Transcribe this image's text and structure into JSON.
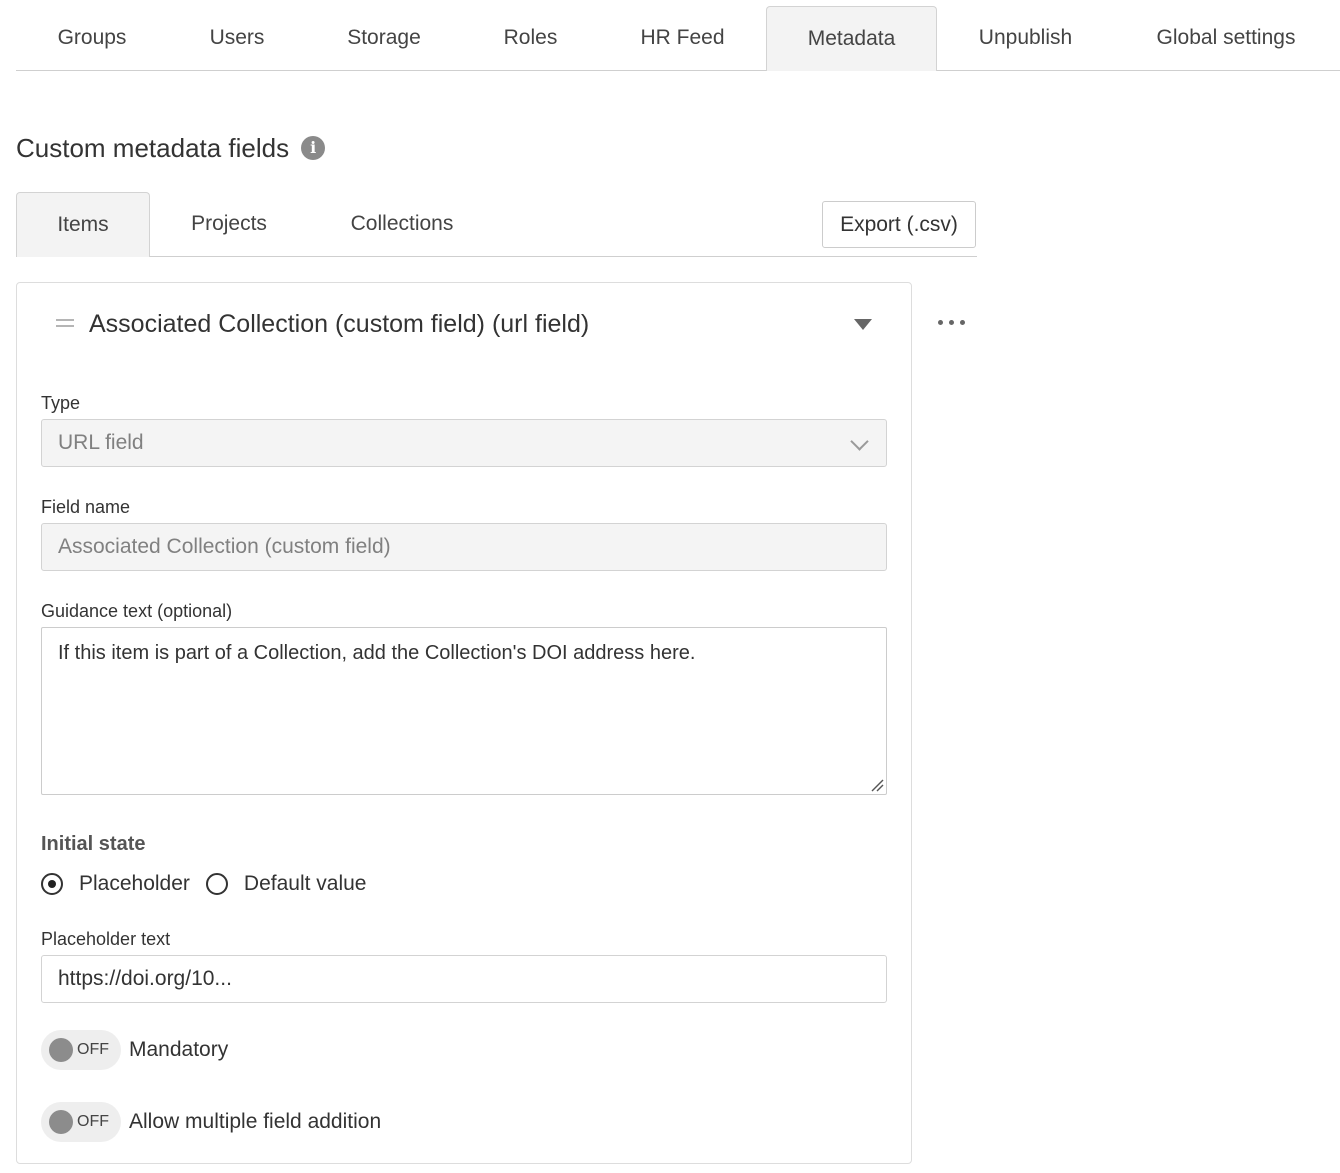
{
  "top_nav": {
    "tabs": [
      {
        "label": "Groups"
      },
      {
        "label": "Users"
      },
      {
        "label": "Storage"
      },
      {
        "label": "Roles"
      },
      {
        "label": "HR Feed"
      },
      {
        "label": "Metadata",
        "active": true
      },
      {
        "label": "Unpublish"
      },
      {
        "label": "Global settings"
      }
    ]
  },
  "section": {
    "title": "Custom metadata fields",
    "info_icon": "info-icon"
  },
  "sub_tabs": {
    "tabs": [
      {
        "label": "Items",
        "active": true
      },
      {
        "label": "Projects"
      },
      {
        "label": "Collections"
      }
    ],
    "export_label": "Export (.csv)"
  },
  "field_card": {
    "title": "Associated Collection (custom field) (url field)",
    "type": {
      "label": "Type",
      "value": "URL field"
    },
    "field_name": {
      "label": "Field name",
      "value": "Associated Collection (custom field)"
    },
    "guidance": {
      "label": "Guidance text (optional)",
      "value": "If this item is part of a Collection, add the Collection's DOI address here."
    },
    "initial_state": {
      "heading": "Initial state",
      "options": [
        {
          "label": "Placeholder",
          "checked": true
        },
        {
          "label": "Default value",
          "checked": false
        }
      ]
    },
    "placeholder_text": {
      "label": "Placeholder text",
      "value": "https://doi.org/10..."
    },
    "toggles": [
      {
        "state": "OFF",
        "label": "Mandatory"
      },
      {
        "state": "OFF",
        "label": "Allow multiple field addition"
      }
    ]
  }
}
